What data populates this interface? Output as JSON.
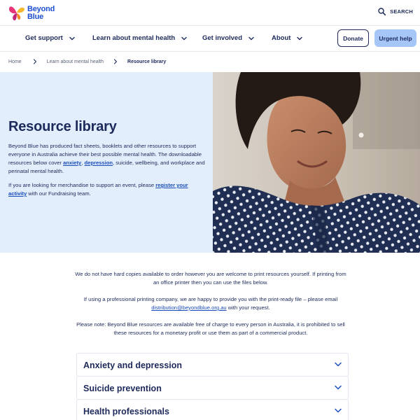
{
  "header": {
    "logo_line1": "Beyond",
    "logo_line2": "Blue",
    "search_label": "SEARCH"
  },
  "nav": {
    "items": [
      {
        "label": "Get support"
      },
      {
        "label": "Learn about mental health"
      },
      {
        "label": "Get involved"
      },
      {
        "label": "About"
      }
    ],
    "donate_label": "Donate",
    "urgent_label": "Urgent help"
  },
  "breadcrumb": [
    "Home",
    "Learn about mental health",
    "Resource library"
  ],
  "hero": {
    "title": "Resource library",
    "p1_part1": "Beyond Blue has produced fact sheets, booklets and other resources to support everyone in Australia achieve their best possible mental health. The downloadable resources below cover ",
    "p1_link1": "anxiety",
    "p1_sep": ", ",
    "p1_link2": "depression",
    "p1_part2": ", suicide, wellbeing, and workplace and perinatal mental health.",
    "p2_part1": "If you are looking for merchandise to support an event, please ",
    "p2_link": "register your activity",
    "p2_part2": " with our Fundraising team."
  },
  "intro": {
    "p1": "We do not have hard copies available to order however you are welcome to print resources yourself. If printing from an office printer then you can use the files below.",
    "p2_part1": "If using a professional printing company, we are happy to provide you with the print-ready file – please email ",
    "p2_link": "distribution@beyondblue.org.au",
    "p2_part2": " with your request.",
    "p3": "Please note: Beyond Blue resources are available free of charge to every person in Australia, it is prohibited to sell these resources for a monetary profit or use them as part of a commercial product."
  },
  "accordions": [
    {
      "label": "Anxiety and depression"
    },
    {
      "label": "Suicide prevention"
    },
    {
      "label": "Health professionals"
    }
  ],
  "colors": {
    "navy": "#1d2a5b",
    "brand_blue": "#1d4fd0",
    "link": "#1a4dba",
    "hero_bg": "#e2eefc",
    "urgent_bg": "#a6c6f7",
    "butterfly_pink": "#e8357a",
    "butterfly_yellow": "#f5b82e"
  }
}
